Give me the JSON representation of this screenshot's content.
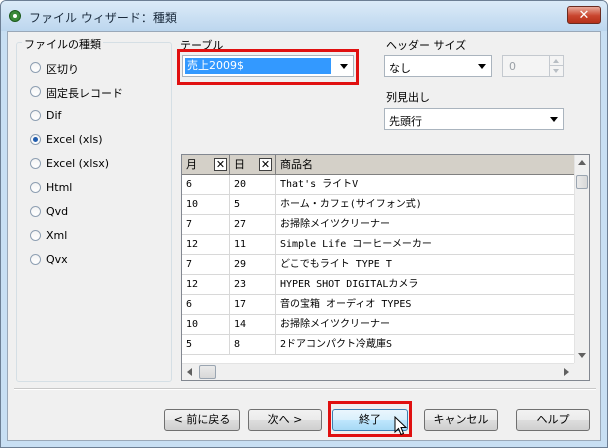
{
  "window": {
    "title": "ファイル ウィザード：種類",
    "close_label": "✕"
  },
  "file_types": {
    "label": "ファイルの種類",
    "options": [
      {
        "label": "区切り",
        "selected": false
      },
      {
        "label": "固定長レコード",
        "selected": false
      },
      {
        "label": "Dif",
        "selected": false
      },
      {
        "label": "Excel (xls)",
        "selected": true
      },
      {
        "label": "Excel (xlsx)",
        "selected": false
      },
      {
        "label": "Html",
        "selected": false
      },
      {
        "label": "Qvd",
        "selected": false
      },
      {
        "label": "Xml",
        "selected": false
      },
      {
        "label": "Qvx",
        "selected": false
      }
    ]
  },
  "table": {
    "label": "テーブル",
    "value": "売上2009$"
  },
  "header_size": {
    "label": "ヘッダー サイズ",
    "value": "なし",
    "spin_value": "0"
  },
  "column_labels": {
    "label": "列見出し",
    "value": "先頭行"
  },
  "grid": {
    "columns": [
      {
        "label": "月",
        "close": "✕"
      },
      {
        "label": "日",
        "close": "✕"
      },
      {
        "label": "商品名",
        "close": ""
      }
    ],
    "rows": [
      [
        "6",
        "20",
        "That's ライトV"
      ],
      [
        "10",
        "5",
        "ホーム・カフェ(サイフォン式)"
      ],
      [
        "7",
        "27",
        "お掃除メイツクリーナー"
      ],
      [
        "12",
        "11",
        "Simple Life コーヒーメーカー"
      ],
      [
        "7",
        "29",
        "どこでもライト TYPE T"
      ],
      [
        "12",
        "23",
        "HYPER SHOT DIGITALカメラ"
      ],
      [
        "6",
        "17",
        "音の宝箱 オーディオ TYPES"
      ],
      [
        "10",
        "14",
        "お掃除メイツクリーナー"
      ],
      [
        "5",
        "8",
        "2ドアコンパクト冷蔵庫S"
      ]
    ]
  },
  "buttons": {
    "back": "< 前に戻る",
    "next": "次へ >",
    "finish": "終了",
    "cancel": "キャンセル",
    "help": "ヘルプ"
  },
  "colors": {
    "highlight": "#e01010",
    "selection": "#3399ff"
  }
}
